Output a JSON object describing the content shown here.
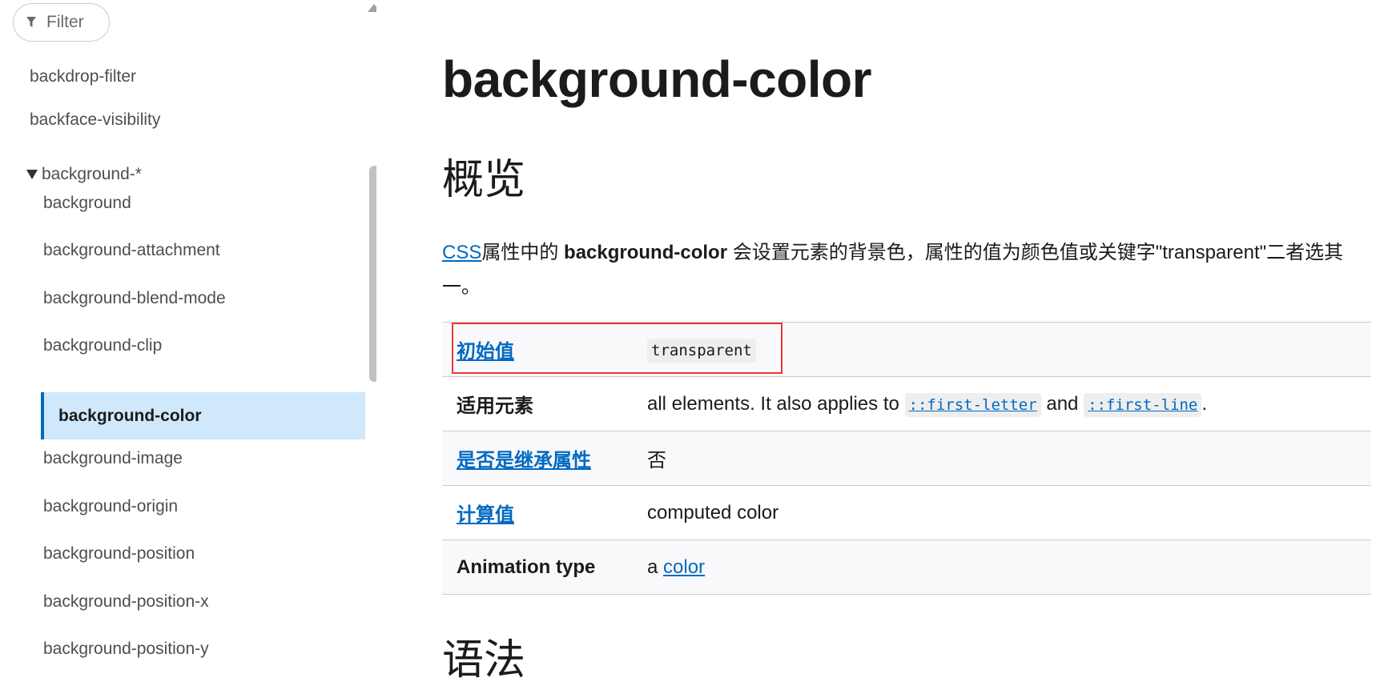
{
  "sidebar": {
    "filter_placeholder": "Filter",
    "items": [
      {
        "label": "backdrop-filter"
      },
      {
        "label": "backface-visibility"
      }
    ],
    "group_label": "background-*",
    "sub_items": [
      {
        "label": "background"
      },
      {
        "label": "background-attachment"
      },
      {
        "label": "background-blend-mode"
      },
      {
        "label": "background-clip"
      }
    ],
    "active_item": "background-color",
    "sub_items_after": [
      {
        "label": "background-image"
      },
      {
        "label": "background-origin"
      },
      {
        "label": "background-position"
      },
      {
        "label": "background-position-x"
      },
      {
        "label": "background-position-y"
      }
    ]
  },
  "main": {
    "title": "background-color",
    "overview_heading": "概览",
    "intro": {
      "css_link": "CSS",
      "part1": "属性中的 ",
      "bold_term": "background-color",
      "part2": " 会设置元素的背景色，属性的值为颜色值或关键字\"transparent\"二者选其一。"
    },
    "table": {
      "initial_value": {
        "key": "初始值",
        "value": "transparent"
      },
      "applies_to": {
        "key": "适用元素",
        "text1": "all elements. It also applies to ",
        "code1": "::first-letter",
        "text2": " and ",
        "code2": "::first-line",
        "text3": "."
      },
      "inherited": {
        "key": "是否是继承属性",
        "value": "否"
      },
      "computed": {
        "key": "计算值",
        "value": "computed color"
      },
      "animation": {
        "key": "Animation type",
        "prefix": "a ",
        "link": "color"
      }
    },
    "syntax_heading": "语法"
  },
  "colors": {
    "link": "#0069c2",
    "active_bg": "#cfe8fc",
    "highlight_border": "#e53935"
  }
}
